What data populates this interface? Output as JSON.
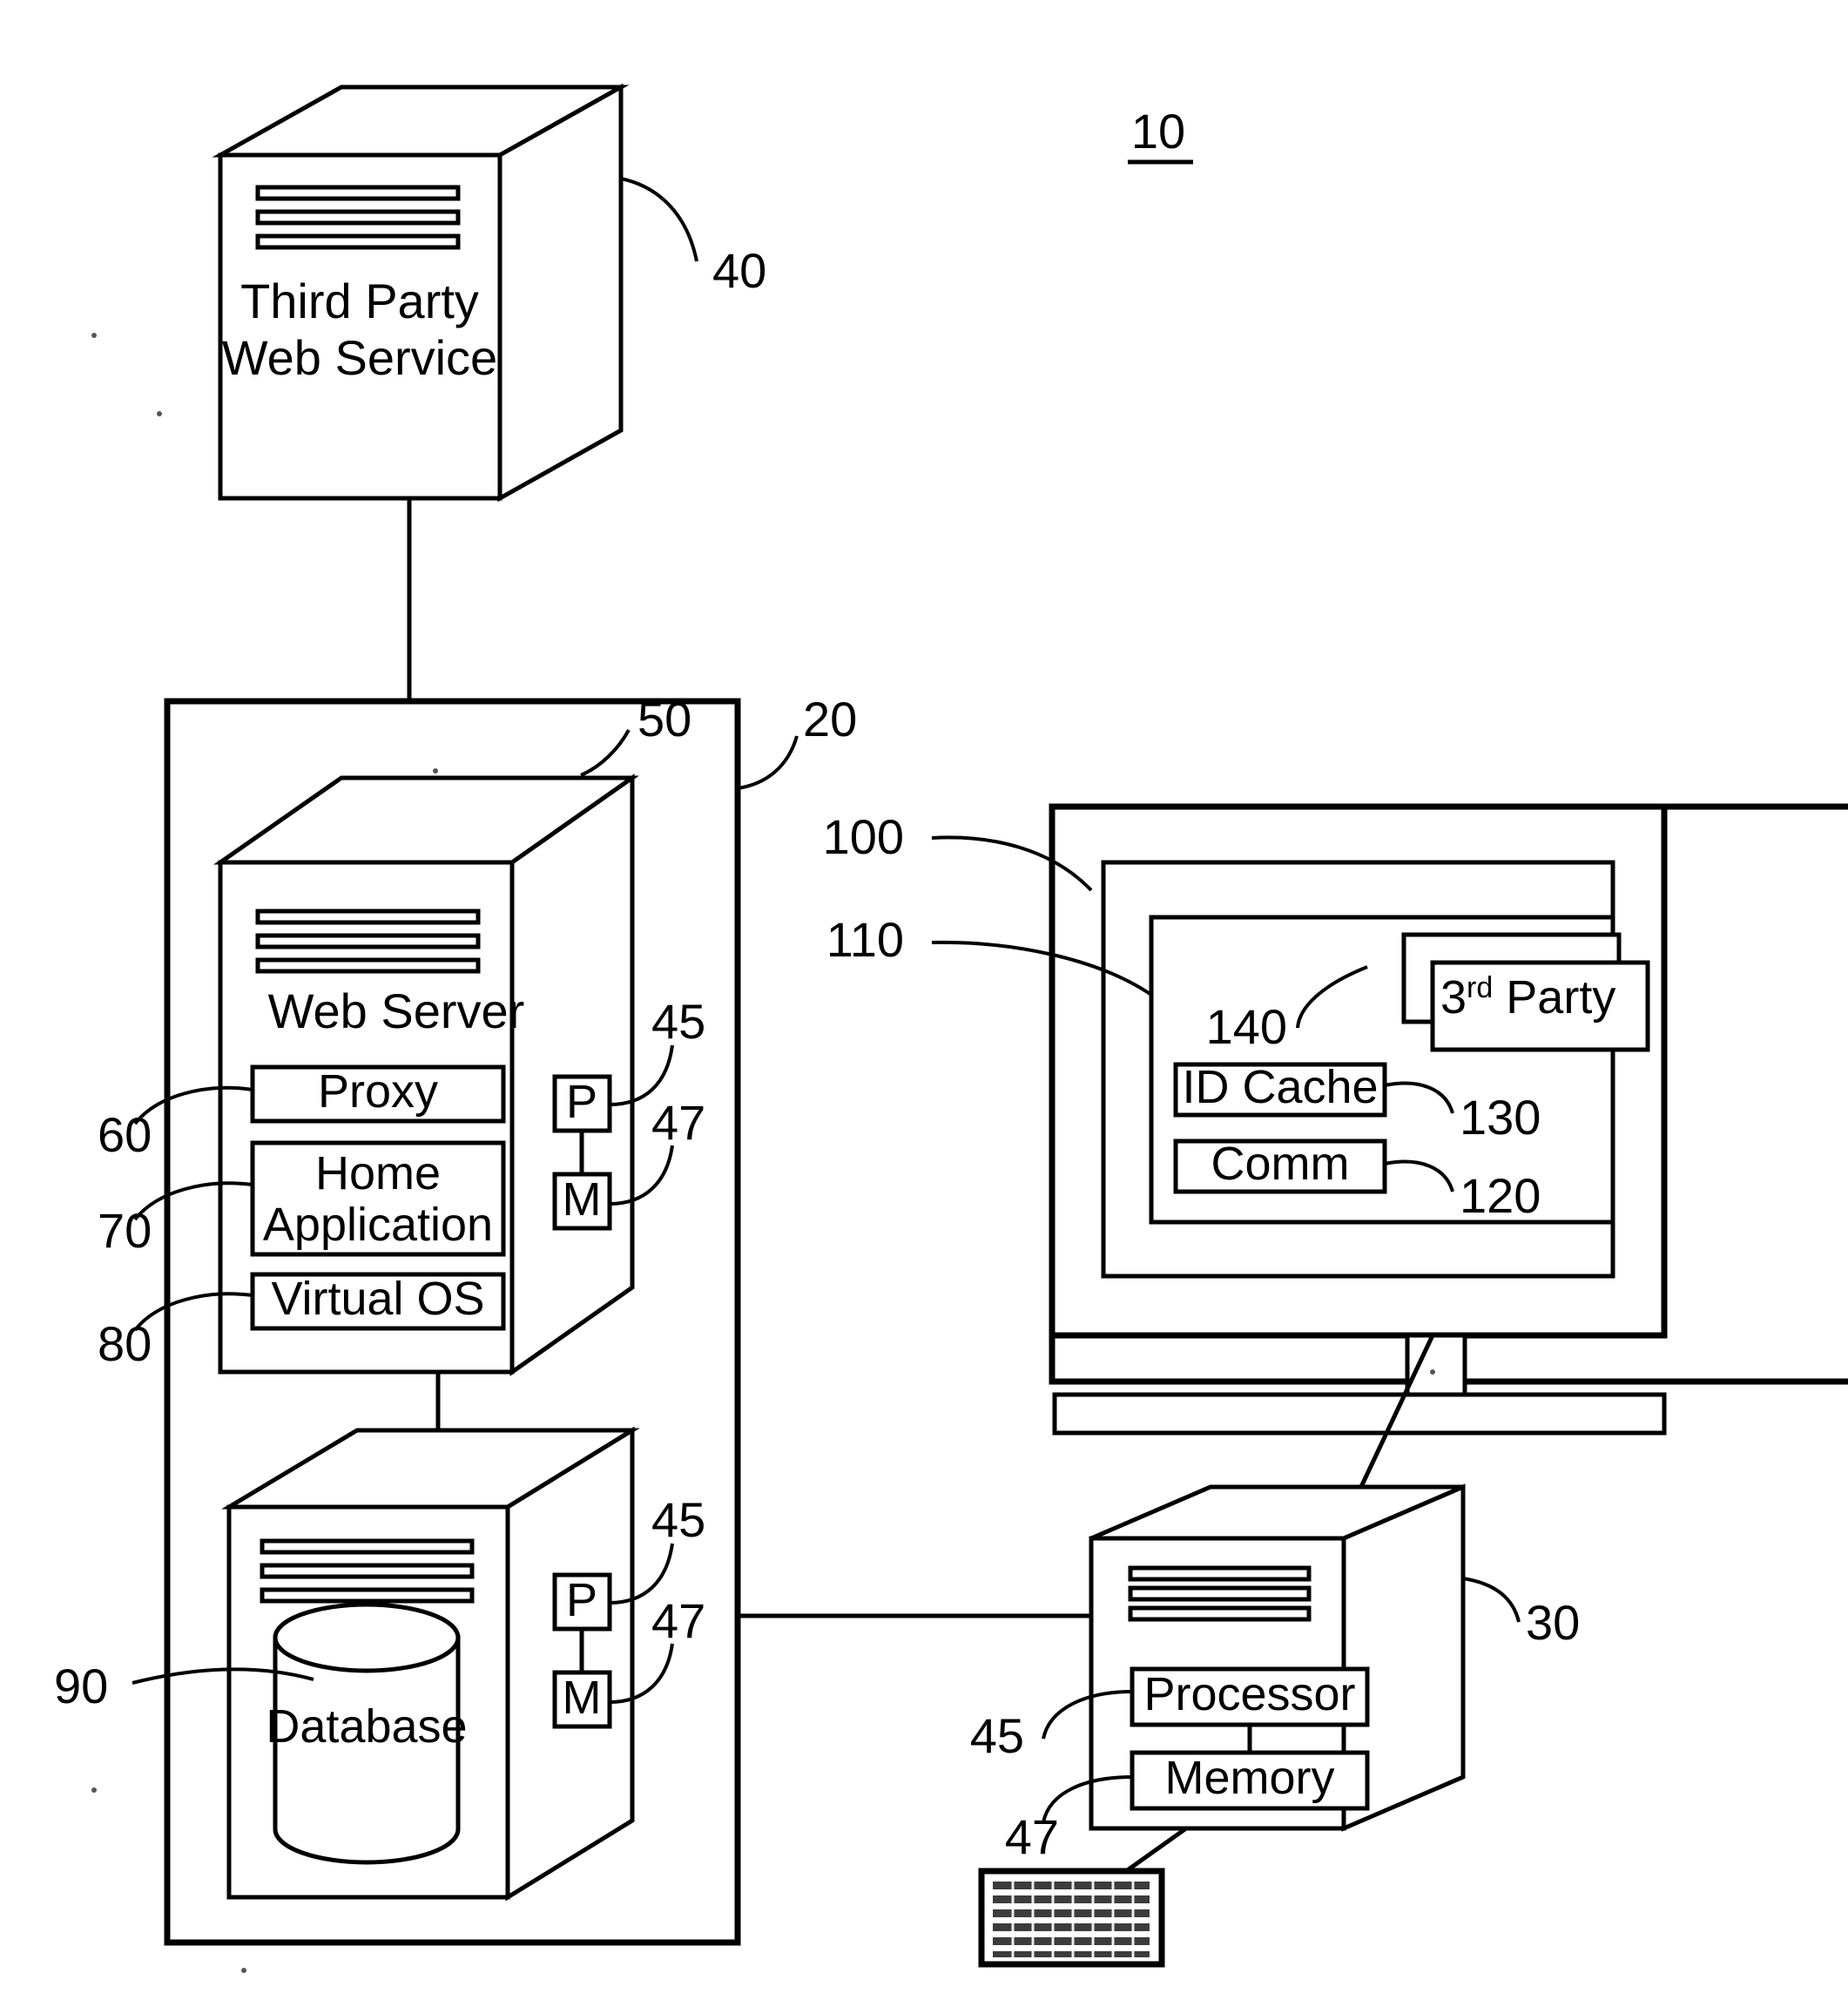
{
  "figure": {
    "number": "10",
    "type": "system architecture block diagram"
  },
  "nodes": {
    "third_party_web_service": {
      "label_line1": "Third Party",
      "label_line2": "Web Service",
      "ref": "40",
      "icon": "server-tower-icon"
    },
    "system_container": {
      "ref": "20"
    },
    "web_server": {
      "label": "Web Server",
      "ref": "50",
      "icon": "server-tower-icon",
      "components": [
        {
          "label": "Proxy",
          "ref": "60"
        },
        {
          "label": "Home Application",
          "label_line1": "Home",
          "label_line2": "Application",
          "ref": "70"
        },
        {
          "label": "Virtual OS",
          "ref": "80"
        }
      ],
      "side_modules": [
        {
          "label": "P",
          "ref": "45",
          "name": "processor"
        },
        {
          "label": "M",
          "ref": "47",
          "name": "memory"
        }
      ]
    },
    "database": {
      "label": "Database",
      "ref": "90",
      "icon": "database-cylinder-icon",
      "side_modules": [
        {
          "label": "P",
          "ref": "45",
          "name": "processor"
        },
        {
          "label": "M",
          "ref": "47",
          "name": "memory"
        }
      ]
    },
    "client_monitor": {
      "ref_outer": "100",
      "ref_inner": "110",
      "icon": "monitor-icon",
      "windows": [
        {
          "label": "3rd Party",
          "label_base": "3",
          "label_sup": "rd",
          "label_rest": " Party",
          "ref": "140"
        }
      ],
      "modules": [
        {
          "label": "ID Cache",
          "ref": "130"
        },
        {
          "label": "Comm",
          "ref": "120"
        }
      ]
    },
    "client_computer": {
      "ref": "30",
      "icon": "computer-tower-icon",
      "components": [
        {
          "label": "Processor",
          "ref": "45"
        },
        {
          "label": "Memory",
          "ref": "47"
        }
      ]
    },
    "keyboard": {
      "icon": "keyboard-icon",
      "label": ""
    }
  },
  "refs_all": [
    "10",
    "20",
    "30",
    "40",
    "45",
    "47",
    "50",
    "60",
    "70",
    "80",
    "90",
    "100",
    "110",
    "120",
    "130",
    "140"
  ],
  "colors": {
    "ink": "#000000",
    "paper": "#ffffff"
  }
}
